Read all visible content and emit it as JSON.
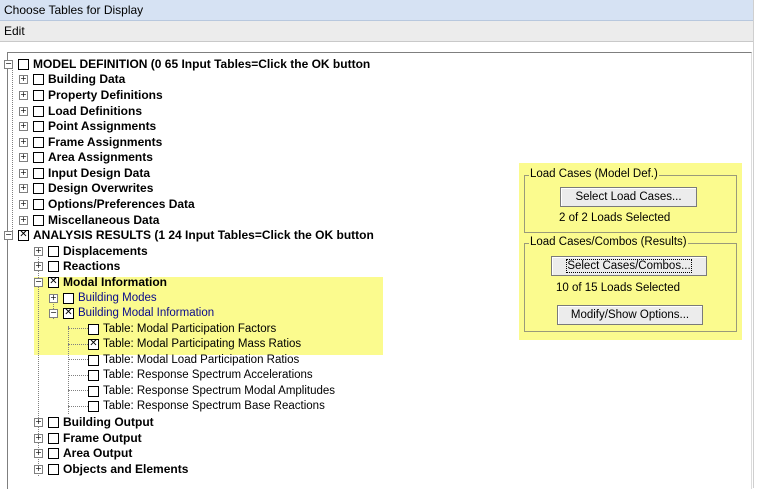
{
  "window": {
    "title": "Choose Tables for Display"
  },
  "menu": {
    "items": [
      "Edit"
    ]
  },
  "tree": [
    {
      "label": "MODEL DEFINITION  (0  65 Input Tables=Click the OK button",
      "checked": false,
      "expanded": true
    },
    {
      "label": "Building Data",
      "checked": false
    },
    {
      "label": "Property Definitions",
      "checked": false
    },
    {
      "label": "Load Definitions",
      "checked": false
    },
    {
      "label": "Point Assignments",
      "checked": false
    },
    {
      "label": "Frame Assignments",
      "checked": false
    },
    {
      "label": "Area Assignments",
      "checked": false
    },
    {
      "label": "Input Design Data",
      "checked": false
    },
    {
      "label": "Design Overwrites",
      "checked": false
    },
    {
      "label": "Options/Preferences Data",
      "checked": false
    },
    {
      "label": "Miscellaneous Data",
      "checked": false
    },
    {
      "label": "ANALYSIS RESULTS  (1  24 Input Tables=Click the OK button",
      "checked": true,
      "expanded": true
    },
    {
      "label": "Displacements",
      "checked": false
    },
    {
      "label": "Reactions",
      "checked": false
    },
    {
      "label": "Modal Information",
      "checked": true,
      "expanded": true
    },
    {
      "label": "Building Modes",
      "checked": false
    },
    {
      "label": "Building Modal Information",
      "checked": true,
      "expanded": true
    },
    {
      "label": "Table:  Modal Participation Factors",
      "checked": false
    },
    {
      "label": "Table:  Modal Participating Mass Ratios",
      "checked": true
    },
    {
      "label": "Table:  Modal Load Participation Ratios",
      "checked": false
    },
    {
      "label": "Table:  Response Spectrum Accelerations",
      "checked": false
    },
    {
      "label": "Table:  Response Spectrum Modal Amplitudes",
      "checked": false
    },
    {
      "label": "Table:  Response Spectrum Base Reactions",
      "checked": false
    },
    {
      "label": "Building Output",
      "checked": false
    },
    {
      "label": "Frame Output",
      "checked": false
    },
    {
      "label": "Area Output",
      "checked": false
    },
    {
      "label": "Objects and Elements",
      "checked": false
    }
  ],
  "load_cases": {
    "title": "Load Cases (Model Def.)",
    "button": "Select Load Cases...",
    "status": "2  of  2  Loads Selected"
  },
  "load_combos": {
    "title": "Load Cases/Combos (Results)",
    "button": "Select Cases/Combos...",
    "status": "10  of  15  Loads Selected",
    "options_button": "Modify/Show Options..."
  },
  "colors": {
    "highlight": "#fbfb8e",
    "titlebar": "#d6e2f3",
    "blue_text": "#0a0a8c"
  }
}
